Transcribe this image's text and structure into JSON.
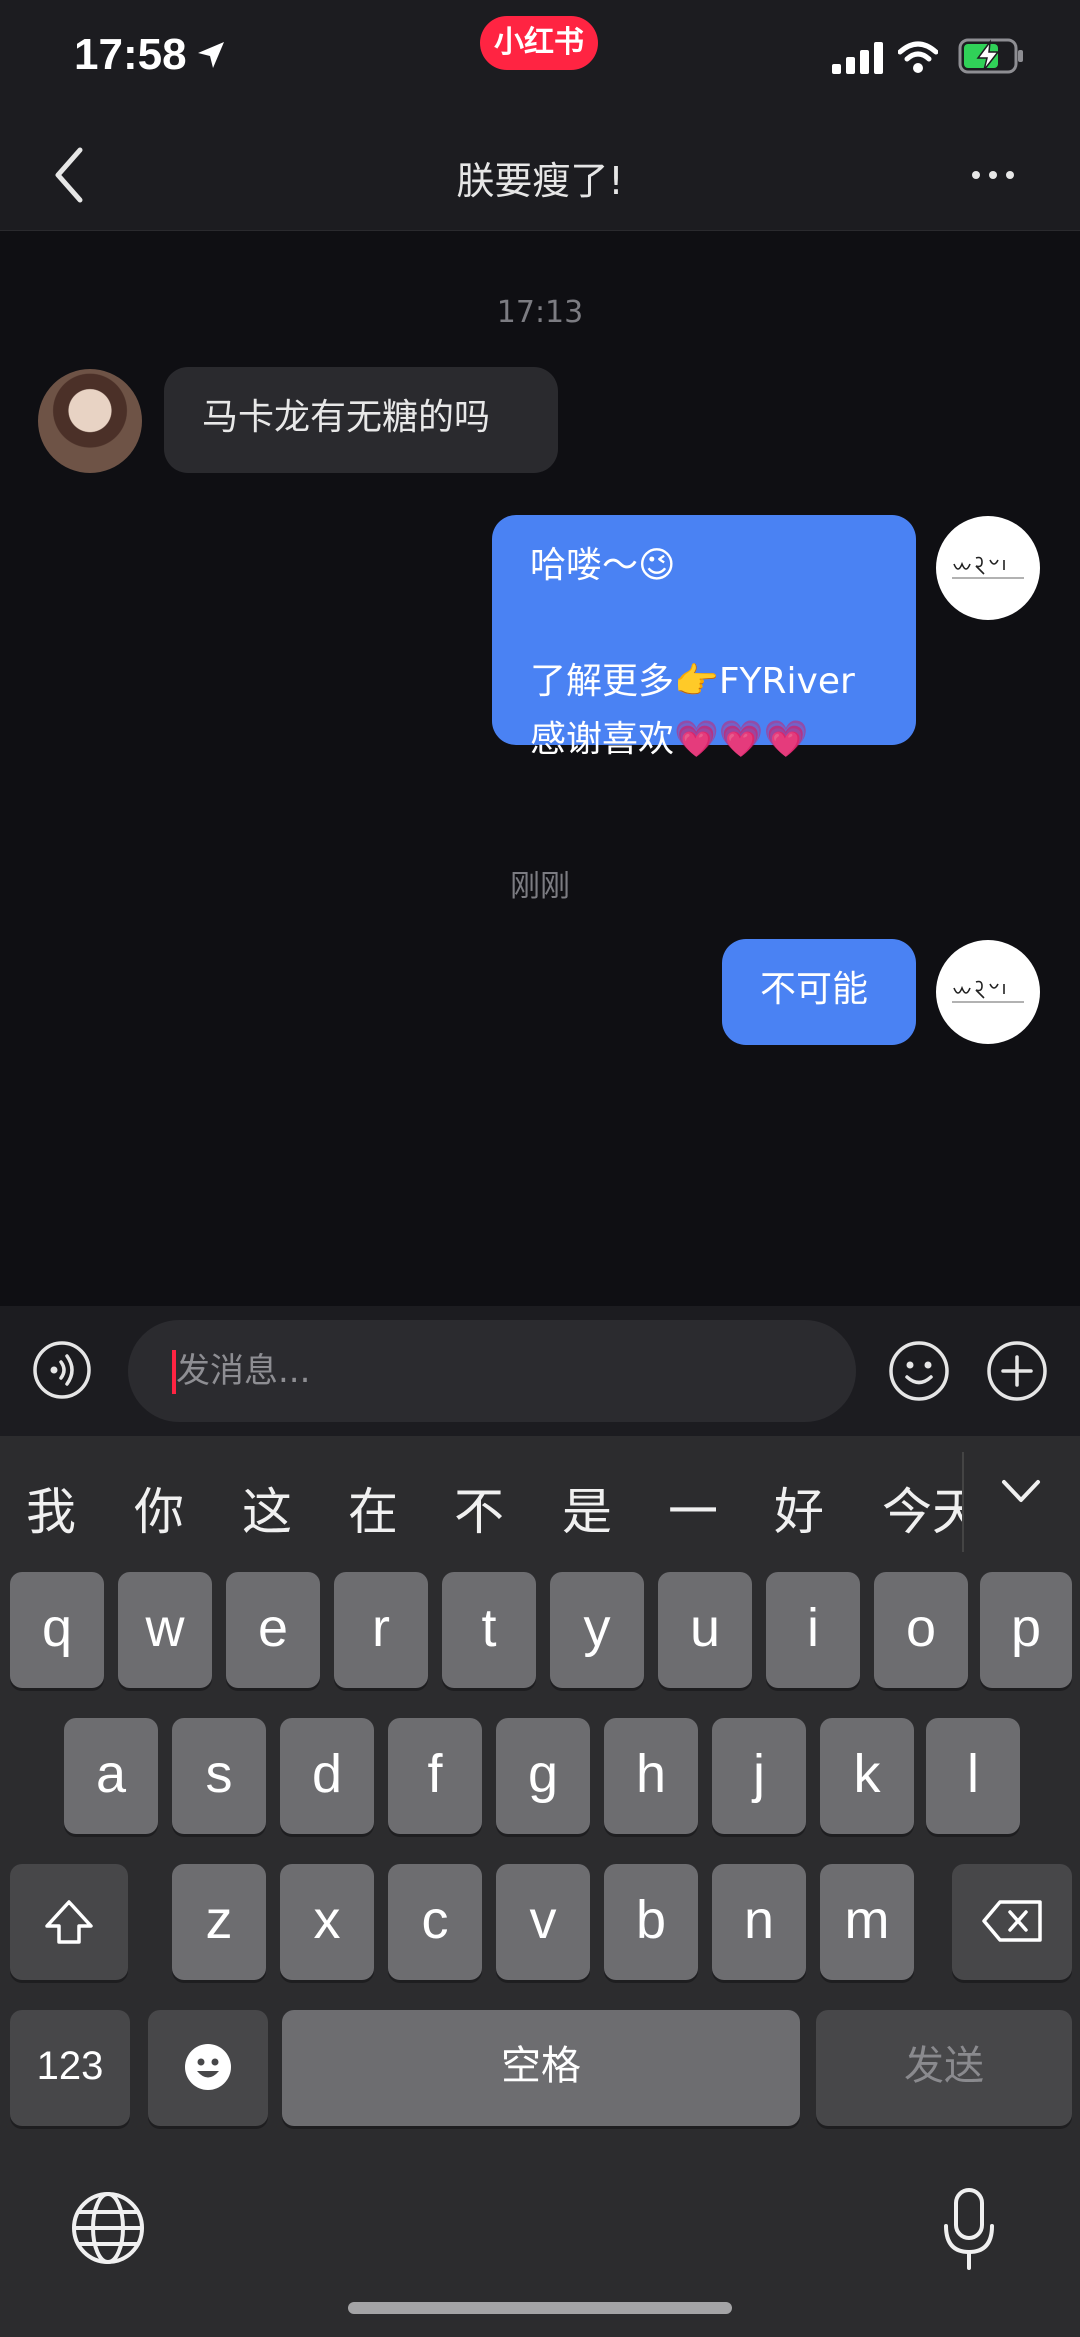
{
  "status_bar": {
    "time": "17:58",
    "app_badge": "小红书"
  },
  "nav": {
    "title": "朕要瘦了!"
  },
  "chat": {
    "timestamp_1": "17:13",
    "incoming_1": "马卡龙有无糖的吗",
    "outgoing_1": [
      "哈喽～😉",
      "",
      "了解更多👉FYRiver",
      "感谢喜欢💗💗💗"
    ],
    "timestamp_2": "刚刚",
    "outgoing_2": "不可能"
  },
  "input": {
    "placeholder": "发消息..."
  },
  "keyboard": {
    "suggestions": [
      "我",
      "你",
      "这",
      "在",
      "不",
      "是",
      "一",
      "好",
      "今天"
    ],
    "row1": [
      "q",
      "w",
      "e",
      "r",
      "t",
      "y",
      "u",
      "i",
      "o",
      "p"
    ],
    "row2": [
      "a",
      "s",
      "d",
      "f",
      "g",
      "h",
      "j",
      "k",
      "l"
    ],
    "row3": [
      "z",
      "x",
      "c",
      "v",
      "b",
      "n",
      "m"
    ],
    "num_key": "123",
    "space_key": "空格",
    "send_key": "发送"
  },
  "colors": {
    "accent": "#ff2442",
    "outgoing_bubble": "#4a82f3",
    "incoming_bubble": "#2a2a2e"
  }
}
